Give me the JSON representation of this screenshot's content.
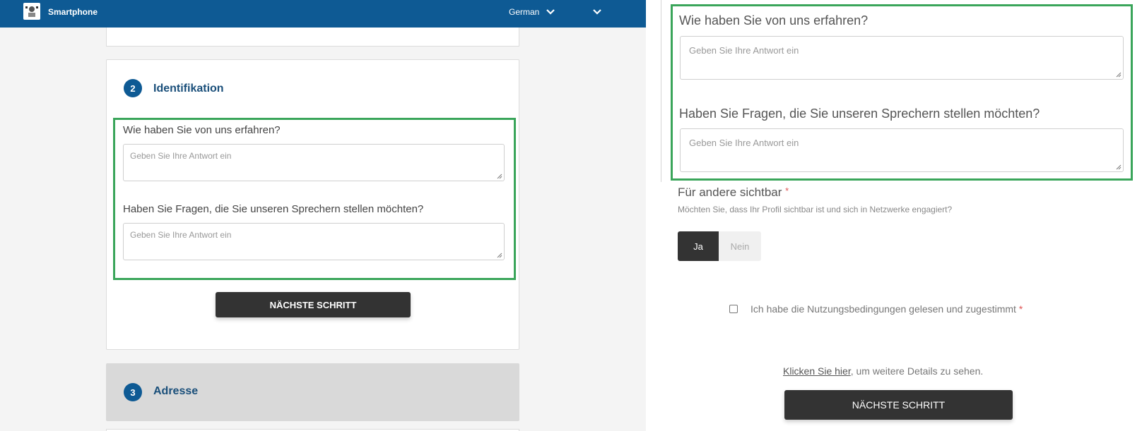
{
  "header": {
    "app_title": "Smartphone",
    "language": "German",
    "language_chevron": "chevron-down-icon",
    "menu_chevron": "chevron-down-icon"
  },
  "left_panel": {
    "step2": {
      "number": "2",
      "title": "Identifikation"
    },
    "question1": {
      "label": "Wie haben Sie von uns erfahren?",
      "placeholder": "Geben Sie Ihre Antwort ein"
    },
    "question2": {
      "label": "Haben Sie Fragen, die Sie unseren Sprechern stellen möchten?",
      "placeholder": "Geben Sie Ihre Antwort ein"
    },
    "next_button": "NÄCHSTE SCHRITT",
    "step3": {
      "number": "3",
      "title": "Adresse"
    }
  },
  "right_panel": {
    "question1": {
      "label": "Wie haben Sie von uns erfahren?",
      "placeholder": "Geben Sie Ihre Antwort ein"
    },
    "question2": {
      "label": "Haben Sie Fragen, die Sie unseren Sprechern stellen möchten?",
      "placeholder": "Geben Sie Ihre Antwort ein"
    },
    "visibility": {
      "label": "Für andere sichtbar",
      "required_mark": "*",
      "description": "Möchten Sie, dass Ihr Profil sichtbar ist und sich in Netzwerke engagiert?",
      "yes": "Ja",
      "no": "Nein",
      "selected": "Ja"
    },
    "terms": {
      "label": "Ich habe die Nutzungsbedingungen gelesen und zugestimmt",
      "required_mark": "*",
      "checked": false
    },
    "details": {
      "link": "Klicken Sie hier",
      "rest": ", um weitere Details zu sehen."
    },
    "next_button": "NÄCHSTE SCHRITT"
  },
  "colors": {
    "header_bg": "#0e5a94",
    "step_circle": "#0e5a94",
    "highlight_box": "#3aa55a",
    "button_bg": "#333333",
    "required": "#e05555"
  }
}
